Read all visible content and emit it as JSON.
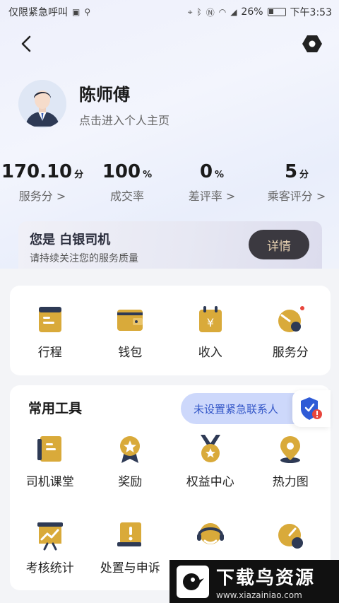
{
  "status_bar": {
    "carrier": "仅限紧急呼叫",
    "battery": "26%",
    "time": "下午3:53"
  },
  "profile": {
    "name": "陈师傅",
    "link": "点击进入个人主页"
  },
  "stats": [
    {
      "value": "170.10",
      "unit": "分",
      "label": "服务分 >"
    },
    {
      "value": "100",
      "unit": "%",
      "label": "成交率"
    },
    {
      "value": "0",
      "unit": "%",
      "label": "差评率 >"
    },
    {
      "value": "5",
      "unit": "分",
      "label": "乘客评分 >"
    }
  ],
  "level_card": {
    "title": "您是 白银司机",
    "subtitle": "请持续关注您的服务质量",
    "button": "详情"
  },
  "quick_menu": [
    "行程",
    "钱包",
    "收入",
    "服务分"
  ],
  "tools": {
    "title": "常用工具",
    "emergency": "未设置紧急联系人",
    "row1": [
      "司机课堂",
      "奖励",
      "权益中心",
      "热力图"
    ],
    "row2": [
      "考核统计",
      "处置与申诉"
    ]
  },
  "watermark": {
    "title": "下载鸟资源",
    "url": "www.xiazainiao.com"
  },
  "colors": {
    "accent_gold": "#d9aa3a",
    "accent_blue": "#3457c8",
    "button_dark": "#3b3940"
  }
}
